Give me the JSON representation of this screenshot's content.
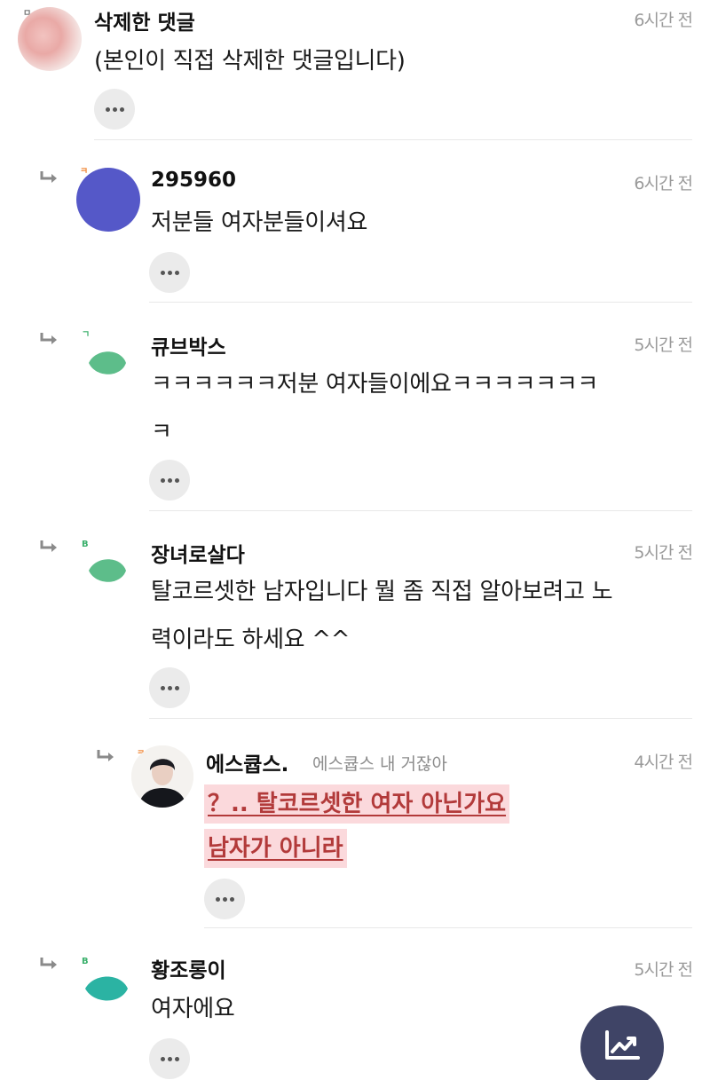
{
  "comments": [
    {
      "nickname": "삭제한 댓글",
      "level": "ㅁ",
      "time": "6시간 전",
      "text": "(본인이 직접 삭제한 댓글입니다)",
      "avatar": "photo-avatar"
    },
    {
      "nickname": "295960",
      "level": "ㅋ",
      "time": "6시간 전",
      "text": "저분들 여자분들이셔요",
      "avatar": "purple-circle-avatar",
      "avatar_color": "#5558c8"
    },
    {
      "nickname": "큐브박스",
      "level": "ㄱ",
      "time": "5시간 전",
      "text": "ㅋㅋㅋㅋㅋㅋ저분 여자들이에요ㅋㅋㅋㅋㅋㅋㅋ\nㅋ",
      "avatar": "leaf-icon",
      "avatar_color": "#5dbd8a"
    },
    {
      "nickname": "장녀로살다",
      "level": "B",
      "time": "5시간 전",
      "text": "탈코르셋한 남자입니다 뭘 좀 직접 알아보려고 노\n력이라도 하세요 ^^",
      "avatar": "leaf-icon",
      "avatar_color": "#5dbd8a"
    },
    {
      "nickname": "에스큡스.",
      "level": "ㅋ",
      "tagline": "에스큡스 내 거잖아",
      "time": "4시간 전",
      "highlight_lines": [
        " ？.. 탈코르셋한 여자 아닌가요",
        "남자가 아니라"
      ],
      "avatar": "photo-avatar"
    },
    {
      "nickname": "황조롱이",
      "level": "B",
      "time": "5시간 전",
      "text": "여자에요",
      "avatar": "leaf-icon",
      "avatar_color": "#2bb3a3"
    }
  ],
  "colors": {
    "level_orange": "#f08a3c",
    "level_green": "#3bb06c",
    "level_gray": "#777777",
    "highlight_bg": "#fbd9dc",
    "highlight_text": "#b23a3a",
    "fab_bg": "#3f4466"
  },
  "fab": {
    "icon": "trending-chart-icon"
  }
}
